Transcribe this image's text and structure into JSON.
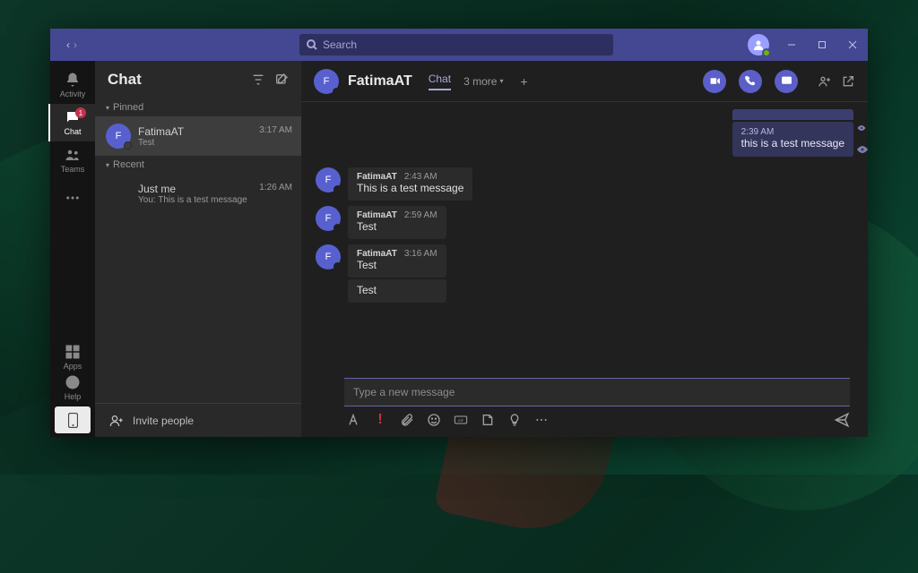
{
  "titlebar": {
    "search_placeholder": "Search"
  },
  "rail": {
    "activity": "Activity",
    "chat": "Chat",
    "chat_badge": "1",
    "teams": "Teams",
    "apps": "Apps",
    "help": "Help"
  },
  "chatlist": {
    "title": "Chat",
    "pinned_label": "Pinned",
    "recent_label": "Recent",
    "pinned": [
      {
        "initial": "F",
        "name": "FatimaAT",
        "preview": "Test",
        "time": "3:17 AM"
      }
    ],
    "recent": [
      {
        "name": "Just me",
        "preview": "You: This is a test message",
        "time": "1:26 AM"
      }
    ],
    "invite": "Invite people"
  },
  "chat": {
    "avatar_initial": "F",
    "name": "FatimaAT",
    "tab_chat": "Chat",
    "more_count": "3 more",
    "outgoing": {
      "time": "2:39 AM",
      "text": "this is a test message"
    },
    "incoming": [
      {
        "name": "FatimaAT",
        "time": "2:43 AM",
        "texts": [
          "This is a test message"
        ]
      },
      {
        "name": "FatimaAT",
        "time": "2:59 AM",
        "texts": [
          "Test"
        ]
      },
      {
        "name": "FatimaAT",
        "time": "3:16 AM",
        "texts": [
          "Test",
          "Test"
        ]
      }
    ],
    "compose_placeholder": "Type a new message"
  }
}
